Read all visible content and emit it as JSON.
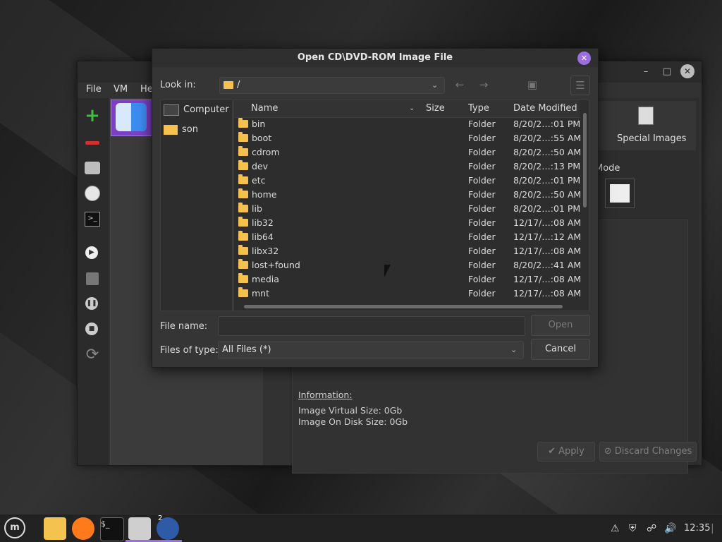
{
  "background_window": {
    "menu": [
      "File",
      "VM",
      "He"
    ],
    "special_images_label": "Special Images",
    "mode_label": "Mode",
    "information": {
      "heading": "Information:",
      "virtual_size": "Image Virtual Size: 0Gb",
      "disk_size": "Image On Disk Size: 0Gb"
    },
    "apply_label": "Apply",
    "discard_label": "Discard Changes"
  },
  "dialog": {
    "title": "Open CD\\DVD-ROM Image File",
    "look_in_label": "Look in:",
    "look_in_value": "/",
    "places": [
      {
        "label": "Computer",
        "icon": "computer-icon"
      },
      {
        "label": "son",
        "icon": "folder-icon"
      }
    ],
    "columns": {
      "name": "Name",
      "size": "Size",
      "type": "Type",
      "date": "Date Modified"
    },
    "files": [
      {
        "name": "bin",
        "type": "Folder",
        "date": "8/20/2…:01 PM"
      },
      {
        "name": "boot",
        "type": "Folder",
        "date": "8/20/2…:55 AM"
      },
      {
        "name": "cdrom",
        "type": "Folder",
        "date": "8/20/2…:50 AM"
      },
      {
        "name": "dev",
        "type": "Folder",
        "date": "8/20/2…:13 PM"
      },
      {
        "name": "etc",
        "type": "Folder",
        "date": "8/20/2…:01 PM"
      },
      {
        "name": "home",
        "type": "Folder",
        "date": "8/20/2…:50 AM"
      },
      {
        "name": "lib",
        "type": "Folder",
        "date": "8/20/2…:01 PM"
      },
      {
        "name": "lib32",
        "type": "Folder",
        "date": "12/17/…:08 AM"
      },
      {
        "name": "lib64",
        "type": "Folder",
        "date": "12/17/…:12 AM"
      },
      {
        "name": "libx32",
        "type": "Folder",
        "date": "12/17/…:08 AM"
      },
      {
        "name": "lost+found",
        "type": "Folder",
        "date": "8/20/2…:41 AM"
      },
      {
        "name": "media",
        "type": "Folder",
        "date": "12/17/…:08 AM"
      },
      {
        "name": "mnt",
        "type": "Folder",
        "date": "12/17/…:08 AM"
      }
    ],
    "file_name_label": "File name:",
    "file_name_value": "",
    "files_of_type_label": "Files of type:",
    "files_of_type_value": "All Files (*)",
    "open_label": "Open",
    "cancel_label": "Cancel"
  },
  "taskbar": {
    "workspace_badge": "2",
    "clock": "12:35"
  }
}
